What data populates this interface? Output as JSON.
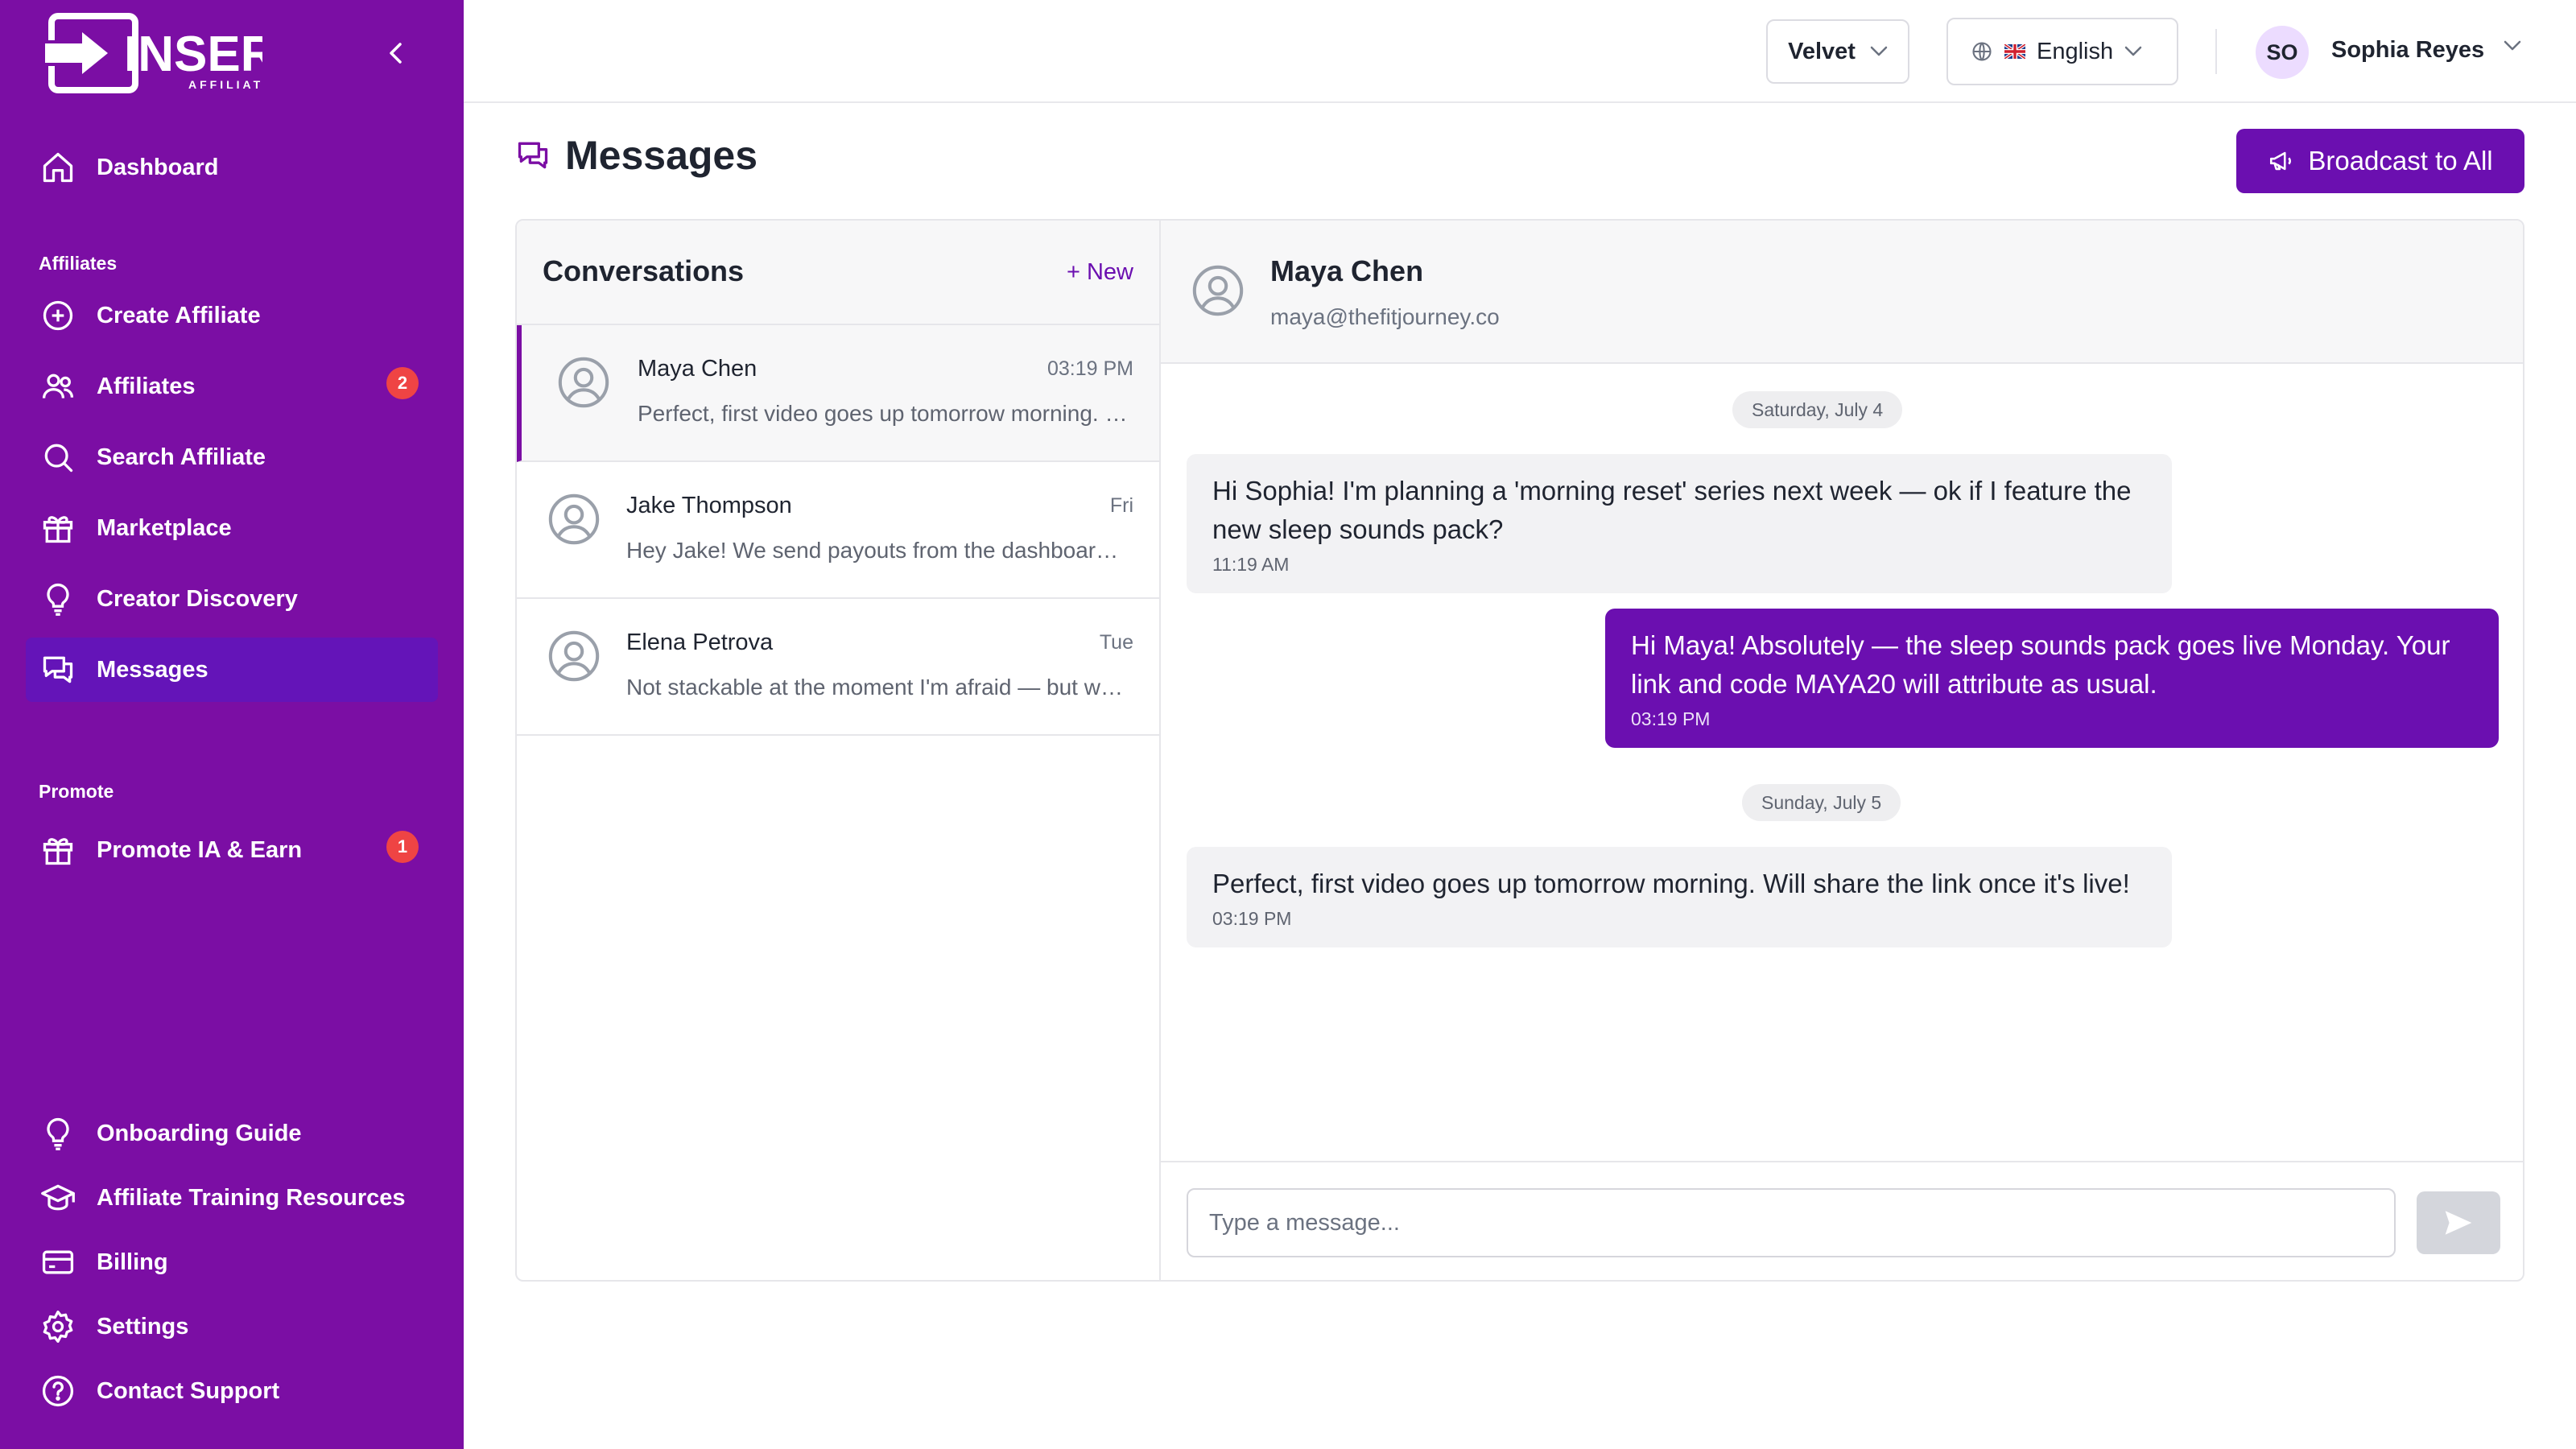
{
  "brand": {
    "name": "INSERT",
    "sub": "AFFILIATE"
  },
  "sidebar": {
    "dashboard": "Dashboard",
    "affiliates_section": "Affiliates",
    "items": [
      {
        "label": "Create Affiliate",
        "icon": "plus-circle-icon"
      },
      {
        "label": "Affiliates",
        "icon": "users-icon",
        "badge": "2"
      },
      {
        "label": "Search Affiliate",
        "icon": "search-icon"
      },
      {
        "label": "Marketplace",
        "icon": "gift-icon"
      },
      {
        "label": "Creator Discovery",
        "icon": "lightbulb-icon"
      },
      {
        "label": "Messages",
        "icon": "chat-icon",
        "active": true
      }
    ],
    "promote_section": "Promote",
    "promote_items": [
      {
        "label": "Promote IA & Earn",
        "icon": "gift-icon",
        "badge": "1"
      }
    ],
    "bottom_items": [
      {
        "label": "Onboarding Guide",
        "icon": "lightbulb-icon"
      },
      {
        "label": "Affiliate Training Resources",
        "icon": "graduation-cap-icon"
      },
      {
        "label": "Billing",
        "icon": "credit-card-icon"
      },
      {
        "label": "Settings",
        "icon": "gear-icon"
      },
      {
        "label": "Contact Support",
        "icon": "help-circle-icon"
      }
    ]
  },
  "topbar": {
    "workspace": "Velvet",
    "language": "English",
    "user_initials": "SO",
    "user_name": "Sophia Reyes"
  },
  "page": {
    "title": "Messages",
    "broadcast_label": "Broadcast to All"
  },
  "conversations": {
    "title": "Conversations",
    "new_label": "+ New",
    "items": [
      {
        "name": "Maya Chen",
        "time": "03:19 PM",
        "preview": "Perfect, first video goes up tomorrow morning. Will share the link once it's live!",
        "active": true
      },
      {
        "name": "Jake Thompson",
        "time": "Fri",
        "preview": "Hey Jake! We send payouts from the dashboard every Friday."
      },
      {
        "name": "Elena Petrova",
        "time": "Tue",
        "preview": "Not stackable at the moment I'm afraid — but we can look into it."
      }
    ]
  },
  "chat": {
    "name": "Maya Chen",
    "email": "maya@thefitjourney.co",
    "date1": "Saturday, July 4",
    "date2": "Sunday, July 5",
    "messages": [
      {
        "direction": "in",
        "text": "Hi Sophia! I'm planning a 'morning reset' series next week — ok if I feature the new sleep sounds pack?",
        "time": "11:19 AM"
      },
      {
        "direction": "out",
        "text": "Hi Maya! Absolutely — the sleep sounds pack goes live Monday. Your link and code MAYA20 will attribute as usual.",
        "time": "03:19 PM"
      },
      {
        "direction": "in",
        "text": "Perfect, first video goes up tomorrow morning. Will share the link once it's live!",
        "time": "03:19 PM"
      }
    ],
    "input_placeholder": "Type a message..."
  },
  "colors": {
    "sidebar": "#7b0ea4",
    "accent": "#6b0fb0",
    "badge": "#ef4444"
  }
}
